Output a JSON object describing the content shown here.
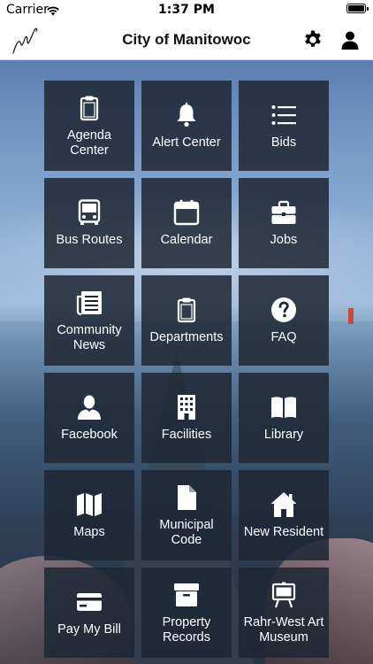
{
  "status_bar": {
    "carrier": "Carrier",
    "time": "1:37 PM"
  },
  "nav": {
    "title": "City of Manitowoc"
  },
  "tiles": [
    {
      "label": "Agenda\nCenter",
      "icon": "clipboard-icon"
    },
    {
      "label": "Alert Center",
      "icon": "bell-icon"
    },
    {
      "label": "Bids",
      "icon": "list-icon"
    },
    {
      "label": "Bus Routes",
      "icon": "bus-icon"
    },
    {
      "label": "Calendar",
      "icon": "calendar-icon"
    },
    {
      "label": "Jobs",
      "icon": "briefcase-icon"
    },
    {
      "label": "Community\nNews",
      "icon": "newspaper-icon"
    },
    {
      "label": "Departments",
      "icon": "clipboard-icon"
    },
    {
      "label": "FAQ",
      "icon": "question-circle-icon"
    },
    {
      "label": "Facebook",
      "icon": "person-icon"
    },
    {
      "label": "Facilities",
      "icon": "building-icon"
    },
    {
      "label": "Library",
      "icon": "book-icon"
    },
    {
      "label": "Maps",
      "icon": "map-icon"
    },
    {
      "label": "Municipal\nCode",
      "icon": "document-icon"
    },
    {
      "label": "New Resident",
      "icon": "home-icon"
    },
    {
      "label": "Pay My Bill",
      "icon": "credit-card-icon"
    },
    {
      "label": "Property\nRecords",
      "icon": "archive-icon"
    },
    {
      "label": "Rahr-West Art\nMuseum",
      "icon": "easel-icon"
    }
  ]
}
